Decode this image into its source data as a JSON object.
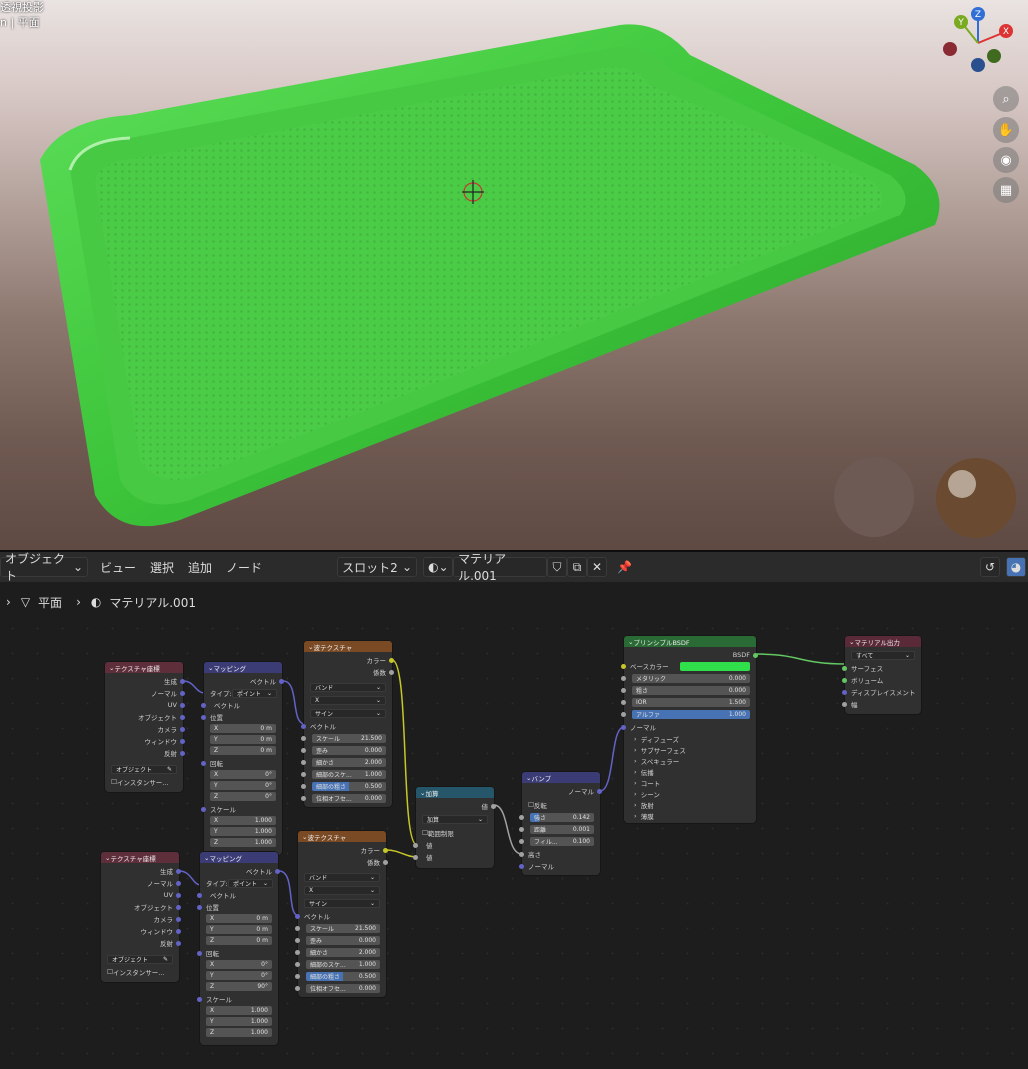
{
  "viewport": {
    "title_line1": "透視投影",
    "title_line2": "n | 平面",
    "axes": {
      "x": "X",
      "y": "Y",
      "z": "Z"
    }
  },
  "header": {
    "mode": "オブジェクト",
    "menus": [
      "ビュー",
      "選択",
      "追加",
      "ノード"
    ],
    "slot": "スロット2",
    "material": "マテリアル.001"
  },
  "breadcrumb": {
    "object": "平面",
    "material": "マテリアル.001"
  },
  "nodes": {
    "texcoord1": {
      "title": "テクスチャ座標",
      "outputs": [
        "生成",
        "ノーマル",
        "UV",
        "オブジェクト",
        "カメラ",
        "ウィンドウ",
        "反射"
      ],
      "object_placeholder": "オブジェクト",
      "instancer": "インスタンサー..."
    },
    "mapping1": {
      "title": "マッピング",
      "out": "ベクトル",
      "type_label": "タイプ:",
      "type": "ポイント",
      "vec": "ベクトル",
      "loc": "位置",
      "loc_vals": [
        [
          "X",
          "0 m"
        ],
        [
          "Y",
          "0 m"
        ],
        [
          "Z",
          "0 m"
        ]
      ],
      "rot": "回転",
      "rot_vals": [
        [
          "X",
          "0°"
        ],
        [
          "Y",
          "0°"
        ],
        [
          "Z",
          "0°"
        ]
      ],
      "scale": "スケール",
      "scale_vals": [
        [
          "X",
          "1.000"
        ],
        [
          "Y",
          "1.000"
        ],
        [
          "Z",
          "1.000"
        ]
      ]
    },
    "wave1": {
      "title": "波テクスチャ",
      "out_color": "カラー",
      "out_fac": "係数",
      "type": "バンド",
      "dir": "X",
      "profile": "サイン",
      "vec": "ベクトル",
      "params": [
        [
          "スケール",
          "21.500"
        ],
        [
          "歪み",
          "0.000"
        ],
        [
          "細かさ",
          "2.000"
        ],
        [
          "細部のスケ...",
          "1.000"
        ],
        [
          "細部の粗さ",
          "0.500"
        ],
        [
          "位相オフセ...",
          "0.000"
        ]
      ]
    },
    "math": {
      "title": "加算",
      "out": "値",
      "op": "加算",
      "clamp": "範囲制限",
      "in1": "値",
      "in2": "値"
    },
    "bump": {
      "title": "バンプ",
      "out": "ノーマル",
      "invert": "反転",
      "params": [
        [
          "強さ",
          "0.142"
        ],
        [
          "距離",
          "0.001"
        ],
        [
          "フィル...",
          "0.100"
        ]
      ],
      "height": "高さ",
      "normal": "ノーマル"
    },
    "bsdf": {
      "title": "プリンシプルBSDF",
      "out": "BSDF",
      "base": "ベースカラー",
      "base_color": "#2fe04a",
      "params": [
        [
          "メタリック",
          "0.000"
        ],
        [
          "粗さ",
          "0.000"
        ],
        [
          "IOR",
          "1.500"
        ],
        [
          "アルファ",
          "1.000"
        ]
      ],
      "normal": "ノーマル",
      "panels": [
        "ディフューズ",
        "サブサーフェス",
        "スペキュラー",
        "伝播",
        "コート",
        "シーン",
        "放射",
        "薄膜"
      ]
    },
    "output": {
      "title": "マテリアル出力",
      "target": "すべて",
      "inputs": [
        "サーフェス",
        "ボリューム",
        "ディスプレイスメント",
        "幅"
      ]
    },
    "texcoord2": {
      "title": "テクスチャ座標",
      "outputs": [
        "生成",
        "ノーマル",
        "UV",
        "オブジェクト",
        "カメラ",
        "ウィンドウ",
        "反射"
      ],
      "object_placeholder": "オブジェクト",
      "instancer": "インスタンサー..."
    },
    "mapping2": {
      "title": "マッピング",
      "out": "ベクトル",
      "type_label": "タイプ:",
      "type": "ポイント",
      "vec": "ベクトル",
      "loc": "位置",
      "loc_vals": [
        [
          "X",
          "0 m"
        ],
        [
          "Y",
          "0 m"
        ],
        [
          "Z",
          "0 m"
        ]
      ],
      "rot": "回転",
      "rot_vals": [
        [
          "X",
          "0°"
        ],
        [
          "Y",
          "0°"
        ],
        [
          "Z",
          "90°"
        ]
      ],
      "scale": "スケール",
      "scale_vals": [
        [
          "X",
          "1.000"
        ],
        [
          "Y",
          "1.000"
        ],
        [
          "Z",
          "1.000"
        ]
      ]
    },
    "wave2": {
      "title": "波テクスチャ",
      "out_color": "カラー",
      "out_fac": "係数",
      "type": "バンド",
      "dir": "X",
      "profile": "サイン",
      "vec": "ベクトル",
      "params": [
        [
          "スケール",
          "21.500"
        ],
        [
          "歪み",
          "0.000"
        ],
        [
          "細かさ",
          "2.000"
        ],
        [
          "細部のスケ...",
          "1.000"
        ],
        [
          "細部の粗さ",
          "0.500"
        ],
        [
          "位相オフセ...",
          "0.000"
        ]
      ]
    }
  }
}
